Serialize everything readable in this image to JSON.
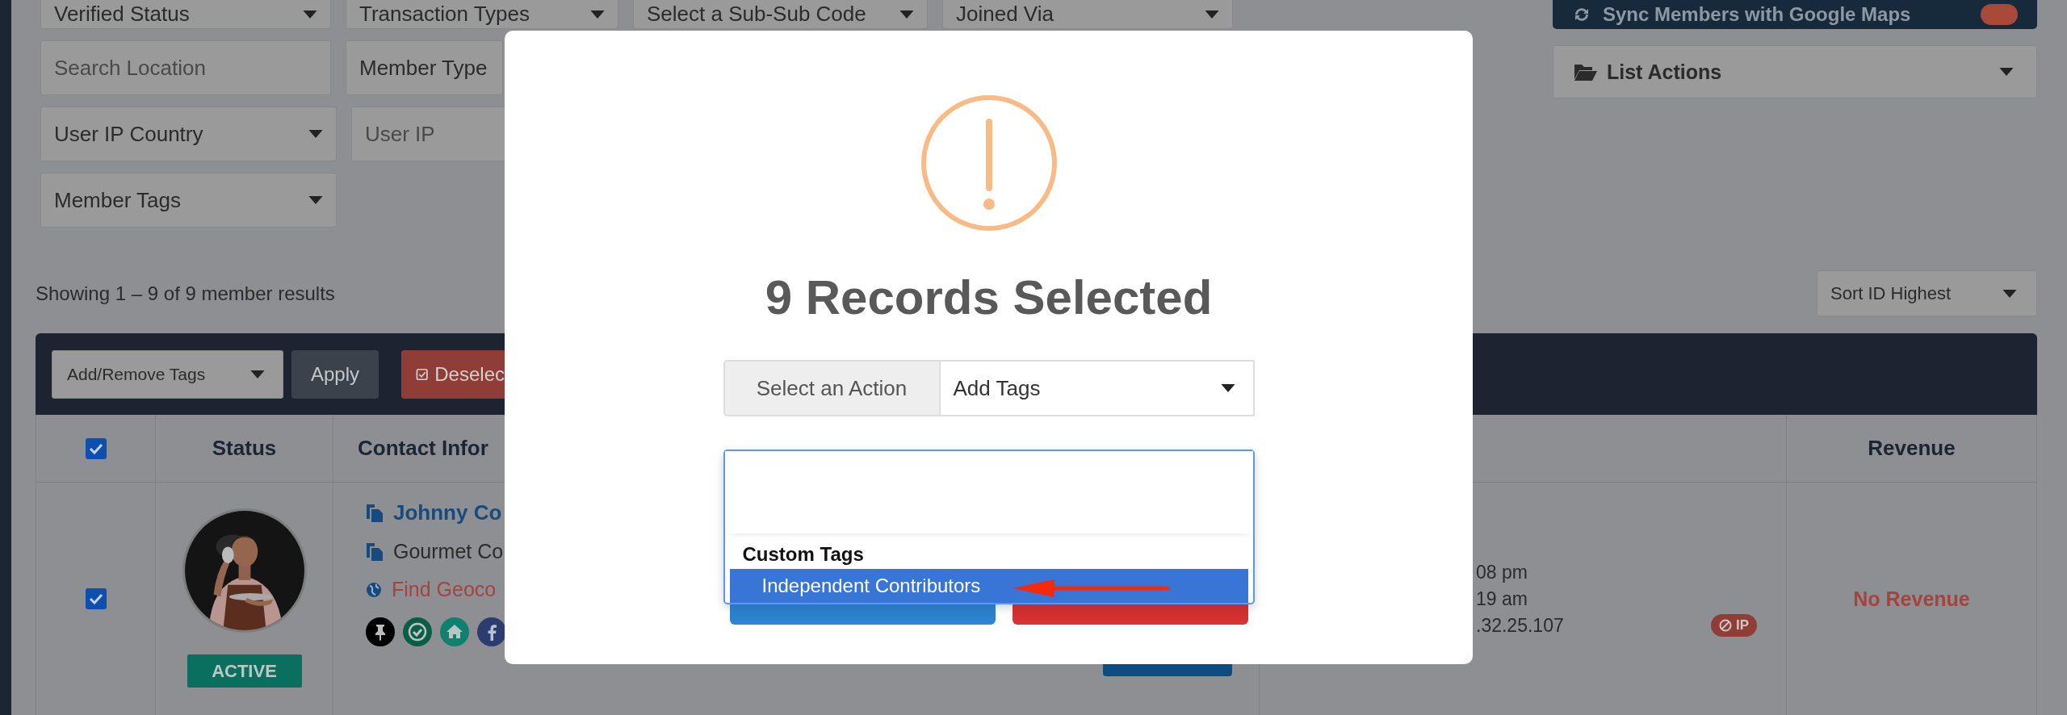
{
  "filters": [
    [
      {
        "kind": "select",
        "label": "Verified Status"
      },
      {
        "kind": "select",
        "label": "Transaction Types"
      },
      {
        "kind": "select",
        "label": "Select a Sub-Sub Code"
      },
      {
        "kind": "select",
        "label": "Joined Via"
      }
    ],
    [
      {
        "kind": "input",
        "label": "Search Location"
      },
      {
        "kind": "partial",
        "label": "Member Type"
      }
    ],
    [
      {
        "kind": "select",
        "label": "User IP Country"
      },
      {
        "kind": "input",
        "label": "User IP"
      }
    ],
    [
      {
        "kind": "select",
        "label": "Member Tags"
      }
    ]
  ],
  "sync_button": {
    "label": "Sync Members with Google Maps"
  },
  "list_actions": {
    "label": "List Actions"
  },
  "results_summary": "Showing 1 – 9 of 9 member results",
  "sort": {
    "label": "Sort ID Highest"
  },
  "toolbar": {
    "bulk_action": "Add/Remove Tags",
    "apply": "Apply",
    "deselect": "Deselec"
  },
  "table": {
    "header_checked": true,
    "columns": [
      "Status",
      "Contact Infor",
      "Revenue"
    ],
    "rows": [
      {
        "checked": true,
        "status": "ACTIVE",
        "name": "Johnny Co",
        "company": "Gourmet Co",
        "geocode": "Find Geoco",
        "column_4": [
          "08 pm",
          "19 am",
          ".32.25.107"
        ],
        "ip_badge": "IP",
        "revenue": "No Revenue"
      }
    ]
  },
  "modal": {
    "title": "9 Records Selected",
    "action_label": "Select an Action",
    "action_value": "Add Tags",
    "dropdown": {
      "groups": [
        {
          "label": "Custom Tags",
          "options": [
            {
              "label": "Independent Contributors",
              "selected": true
            }
          ]
        }
      ]
    }
  }
}
